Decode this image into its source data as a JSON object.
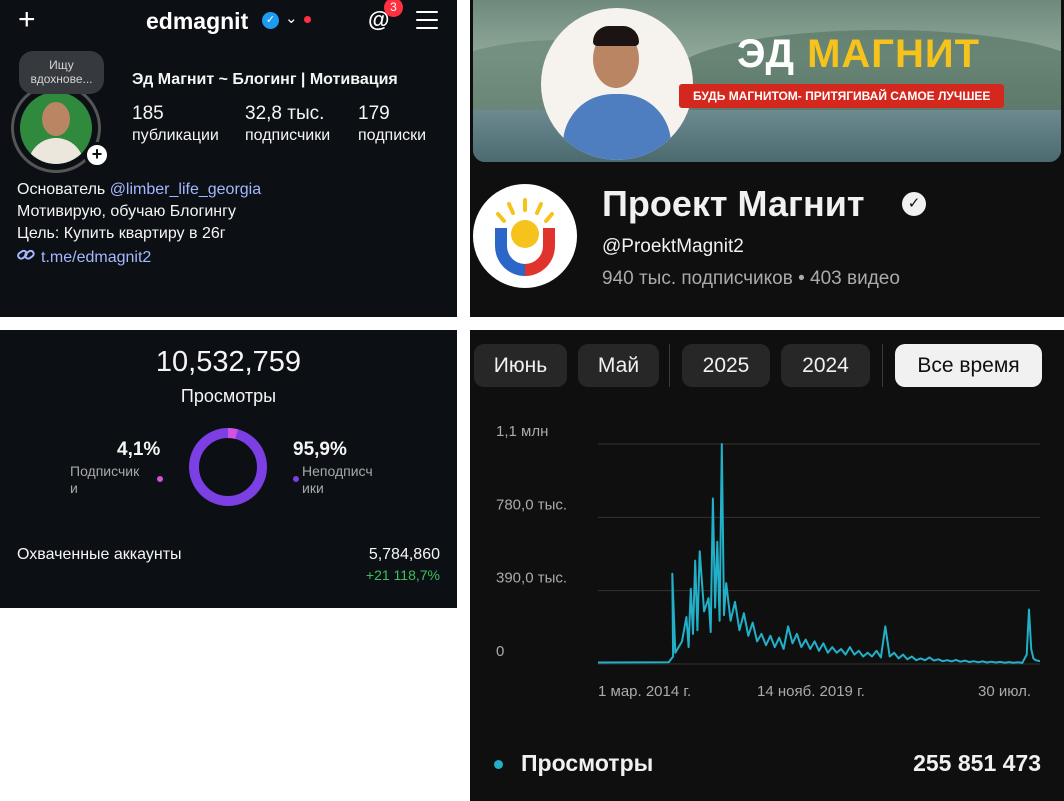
{
  "instagram_profile": {
    "username": "edmagnit",
    "threads_badge": "3",
    "note": "Ищу вдохнове...",
    "display_name": "Эд Магнит ~  Блогинг | Мотивация",
    "stats": [
      {
        "value": "185",
        "label": "публикации"
      },
      {
        "value": "32,8 тыс.",
        "label": "подписчики"
      },
      {
        "value": "179",
        "label": "подписки"
      }
    ],
    "bio_prefix": "Основатель ",
    "bio_mention": "@limber_life_georgia",
    "bio_line2": "Мотивирую, обучаю Блогингу",
    "bio_line3": "Цель: Купить квартиру в 26г",
    "link": "t.me/edmagnit2",
    "icons": [
      "plus-icon",
      "verified-icon",
      "chevron-down-icon",
      "threads-icon",
      "menu-icon",
      "link-icon"
    ]
  },
  "youtube_channel": {
    "banner_title_white": "ЭД ",
    "banner_title_yellow": "МАГНИТ",
    "banner_tagline": "БУДЬ МАГНИТОМ- ПРИТЯГИВАЙ САМОЕ ЛУЧШЕЕ",
    "channel_name": "Проект Магнит",
    "handle": "@ProektMagnit2",
    "subscribers": "940 тыс. подписчиков",
    "separator": "•",
    "videos": "403 видео"
  },
  "insights": {
    "views_total": "10,532,759",
    "views_label": "Просмотры",
    "followers_pct": "4,1%",
    "followers_label": "Подписчик\nи",
    "nonfollowers_pct": "95,9%",
    "nonfollowers_label": "Неподписч\nики",
    "followers_share": 0.041,
    "colors": {
      "followers": "#d052e0",
      "nonfollowers": "#7b3fe4"
    },
    "reach_label": "Охваченные аккаунты",
    "reach_value": "5,784,860",
    "reach_delta": "+21 118,7%"
  },
  "analytics": {
    "tabs": [
      {
        "label": "Июнь",
        "active": false
      },
      {
        "label": "Май",
        "active": false
      },
      {
        "label": "2025",
        "active": false
      },
      {
        "label": "2024",
        "active": false
      },
      {
        "label": "Все время",
        "active": true
      }
    ],
    "legend_label": "Просмотры",
    "legend_total": "255 851 473"
  },
  "chart_data": {
    "type": "line",
    "series": [
      {
        "name": "Просмотры",
        "color": "#21b0c8"
      }
    ],
    "y_tick_labels": [
      "0",
      "390,0 тыс.",
      "780,0 тыс.",
      "1,1 млн"
    ],
    "y_ticks": [
      0,
      390000,
      780000,
      1170000
    ],
    "ylim": [
      0,
      1170000
    ],
    "x_tick_labels": [
      "1 мар. 2014 г.",
      "14 нояб. 2019 г.",
      "30 июл."
    ],
    "grid": true,
    "envelope_note_free": true,
    "points": [
      [
        0.0,
        8000
      ],
      [
        0.16,
        9000
      ],
      [
        0.17,
        40000
      ],
      [
        0.168,
        480000
      ],
      [
        0.175,
        60000
      ],
      [
        0.19,
        120000
      ],
      [
        0.2,
        250000
      ],
      [
        0.205,
        90000
      ],
      [
        0.21,
        400000
      ],
      [
        0.215,
        160000
      ],
      [
        0.22,
        550000
      ],
      [
        0.225,
        180000
      ],
      [
        0.23,
        600000
      ],
      [
        0.24,
        280000
      ],
      [
        0.25,
        350000
      ],
      [
        0.255,
        170000
      ],
      [
        0.26,
        880000
      ],
      [
        0.265,
        300000
      ],
      [
        0.27,
        650000
      ],
      [
        0.275,
        230000
      ],
      [
        0.28,
        1170000
      ],
      [
        0.285,
        260000
      ],
      [
        0.29,
        430000
      ],
      [
        0.3,
        230000
      ],
      [
        0.31,
        330000
      ],
      [
        0.32,
        180000
      ],
      [
        0.33,
        270000
      ],
      [
        0.34,
        150000
      ],
      [
        0.35,
        220000
      ],
      [
        0.36,
        120000
      ],
      [
        0.37,
        160000
      ],
      [
        0.38,
        100000
      ],
      [
        0.39,
        150000
      ],
      [
        0.4,
        90000
      ],
      [
        0.41,
        140000
      ],
      [
        0.42,
        80000
      ],
      [
        0.43,
        200000
      ],
      [
        0.44,
        110000
      ],
      [
        0.45,
        160000
      ],
      [
        0.46,
        90000
      ],
      [
        0.47,
        130000
      ],
      [
        0.48,
        80000
      ],
      [
        0.49,
        120000
      ],
      [
        0.5,
        70000
      ],
      [
        0.51,
        110000
      ],
      [
        0.52,
        60000
      ],
      [
        0.53,
        90000
      ],
      [
        0.54,
        60000
      ],
      [
        0.55,
        80000
      ],
      [
        0.56,
        50000
      ],
      [
        0.57,
        90000
      ],
      [
        0.58,
        50000
      ],
      [
        0.59,
        70000
      ],
      [
        0.6,
        40000
      ],
      [
        0.61,
        60000
      ],
      [
        0.62,
        40000
      ],
      [
        0.63,
        70000
      ],
      [
        0.64,
        35000
      ],
      [
        0.65,
        200000
      ],
      [
        0.66,
        40000
      ],
      [
        0.67,
        60000
      ],
      [
        0.68,
        30000
      ],
      [
        0.69,
        50000
      ],
      [
        0.7,
        25000
      ],
      [
        0.71,
        40000
      ],
      [
        0.72,
        20000
      ],
      [
        0.73,
        30000
      ],
      [
        0.74,
        20000
      ],
      [
        0.75,
        35000
      ],
      [
        0.76,
        18000
      ],
      [
        0.77,
        25000
      ],
      [
        0.78,
        15000
      ],
      [
        0.79,
        20000
      ],
      [
        0.8,
        14000
      ],
      [
        0.81,
        22000
      ],
      [
        0.82,
        12000
      ],
      [
        0.83,
        18000
      ],
      [
        0.84,
        10000
      ],
      [
        0.85,
        15000
      ],
      [
        0.86,
        9000
      ],
      [
        0.87,
        14000
      ],
      [
        0.88,
        8000
      ],
      [
        0.89,
        12000
      ],
      [
        0.9,
        8000
      ],
      [
        0.91,
        11000
      ],
      [
        0.92,
        7000
      ],
      [
        0.93,
        10000
      ],
      [
        0.94,
        7000
      ],
      [
        0.95,
        9000
      ],
      [
        0.96,
        6000
      ],
      [
        0.97,
        50000
      ],
      [
        0.975,
        290000
      ],
      [
        0.98,
        80000
      ],
      [
        0.985,
        30000
      ],
      [
        0.99,
        20000
      ],
      [
        1.0,
        15000
      ]
    ]
  }
}
